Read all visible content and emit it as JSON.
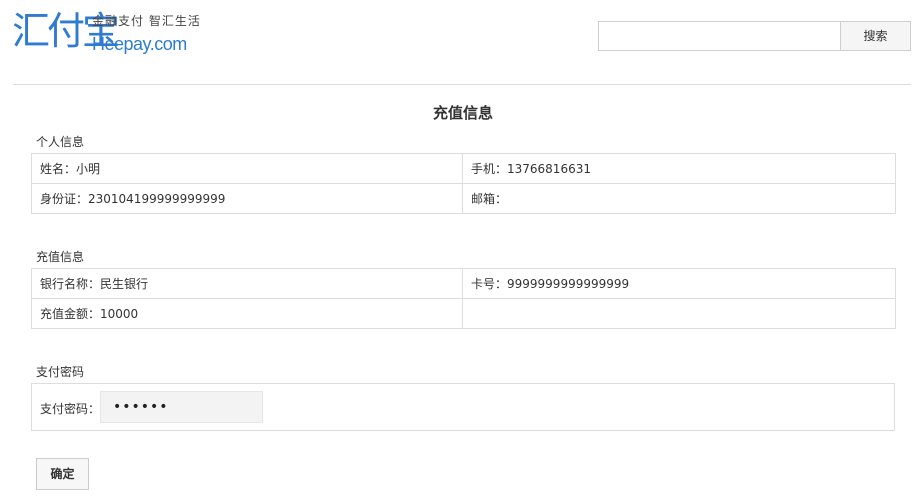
{
  "logo": {
    "main": "汇付宝",
    "slogan": "金融支付 智汇生活",
    "domain": "Heepay.com"
  },
  "search": {
    "value": "",
    "placeholder": "",
    "button_label": "搜索"
  },
  "page_title": "充值信息",
  "personal": {
    "section_label": "个人信息",
    "name": "姓名：小明",
    "phone": "手机：13766816631",
    "id_card": "身份证：230104199999999999",
    "email": "邮箱："
  },
  "recharge": {
    "section_label": "充值信息",
    "bank": "银行名称：民生银行",
    "card": "卡号：9999999999999999",
    "amount": "充值金额：10000"
  },
  "payment": {
    "section_label": "支付密码",
    "password_label": "支付密码：",
    "password_mask": "••••••"
  },
  "confirm_label": "确定"
}
